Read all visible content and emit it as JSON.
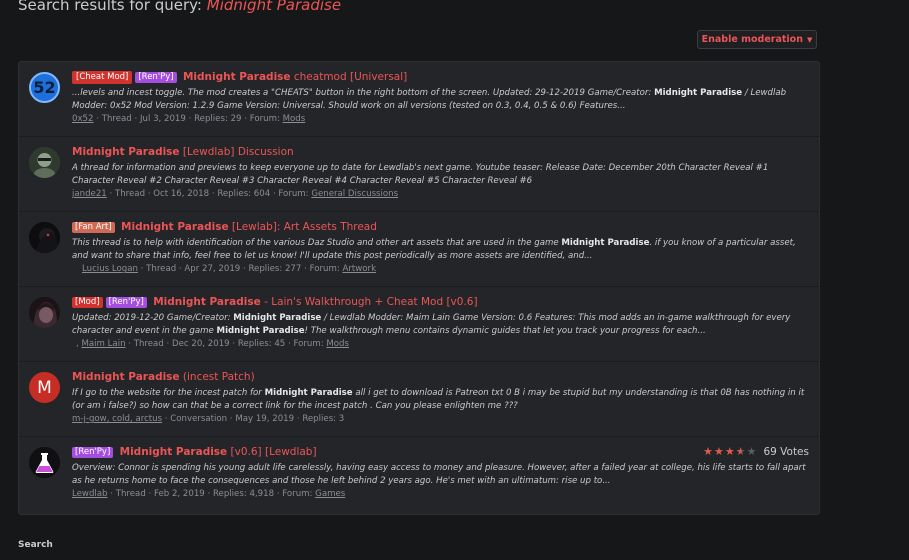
{
  "header": {
    "prefix": "Search results for query: ",
    "query": "Midnight Paradise"
  },
  "moderation_button": {
    "label": "Enable moderation"
  },
  "results": [
    {
      "avatar_text": "52",
      "tags": [
        {
          "text": "[Cheat Mod]",
          "kind": "cheat"
        },
        {
          "text": "[Ren'Py]",
          "kind": "renpy"
        }
      ],
      "title_highlight": "Midnight Paradise",
      "title_rest": " cheatmod [Universal]",
      "snippet_parts": [
        "...levels and incest toggle. The mod creates a \"CHEATS\" button in the right bottom of the screen. Updated: 29-12-2019 Game/Creator: ",
        "Midnight Paradise",
        " / Lewdlab Modder: 0x52 Mod Version: 1.2.9 Game Version: Universal. Should work on all versions (tested on 0.3, 0.4, 0.5 & 0.6) Features..."
      ],
      "author": "0x52",
      "type": "Thread",
      "date": "Jul 3, 2019",
      "replies": "Replies: 29",
      "forum_label": "Forum:",
      "forum": "Mods"
    },
    {
      "tags": [],
      "title_highlight": "Midnight Paradise",
      "title_rest": " [Lewdlab] Discussion",
      "snippet_parts": [
        "A thread for information and previews to keep everyone up to date for Lewdlab's next game. Youtube teaser: Release Date: December 20th Character Reveal #1 Character Reveal #2 Character Reveal #3 Character Reveal #4 Character Reveal #5 Character Reveal #6",
        "",
        ""
      ],
      "author": "jande21",
      "type": "Thread",
      "date": "Oct 16, 2018",
      "replies": "Replies: 604",
      "forum_label": "Forum:",
      "forum": "General Discussions"
    },
    {
      "tags": [
        {
          "text": "[Fan Art]",
          "kind": "fanart"
        }
      ],
      "title_highlight": "Midnight Paradise",
      "title_rest": " [Lewlab]: Art Assets Thread",
      "snippet_parts": [
        "This thread is to help with identification of the various Daz Studio and other art assets that are used in the game ",
        "Midnight Paradise",
        ". if you know of a particular asset, and want to share that info, feel free to let us know! I'll update this post periodically as more assets are identified, and..."
      ],
      "author": "Lucius Logan",
      "type": "Thread",
      "date": "Apr 27, 2019",
      "replies": "Replies: 277",
      "forum_label": "Forum:",
      "forum": "Artwork"
    },
    {
      "tags": [
        {
          "text": "[Mod]",
          "kind": "mod"
        },
        {
          "text": "[Ren'Py]",
          "kind": "renpy"
        }
      ],
      "title_highlight": "Midnight Paradise",
      "title_rest": " - Lain's Walkthrough + Cheat Mod [v0.6]",
      "snippet_parts": [
        "Updated: 2019-12-20 Game/Creator: ",
        "Midnight Paradise",
        " / Lewdlab Modder: Maim Lain Game Version: 0.6 Features: This mod adds an in-game walkthrough for every character and event in the game ",
        "Midnight Paradise",
        "! The walkthrough menu contains dynamic guides that let you track your progress for each..."
      ],
      "author_prefix": ",",
      "author": "Maim Lain",
      "type": "Thread",
      "date": "Dec 20, 2019",
      "replies": "Replies: 45",
      "forum_label": "Forum:",
      "forum": "Mods"
    },
    {
      "avatar_text": "M",
      "tags": [],
      "title_highlight": "Midnight Paradise",
      "title_rest": " (incest Patch)",
      "snippet_parts": [
        "If I go to the website for the incest patch for ",
        "Midnight Paradise",
        " all i get to download is Patreon txt 0 B i may be stupid but my understanding is that 0B has nothing in it (or am i false?) so how can that be a correct link for the incest patch . Can you please enlighten me ???"
      ],
      "author": "m-j-gow, cold, arctus",
      "type": "Conversation",
      "date": "May 19, 2019",
      "replies": "Replies: 3"
    },
    {
      "tags": [
        {
          "text": "[Ren'Py]",
          "kind": "renpy"
        }
      ],
      "title_highlight": "Midnight Paradise",
      "title_rest": " [v0.6] [Lewdlab]",
      "rating_value": 3.5,
      "votes": "69 Votes",
      "snippet_parts": [
        "Overview: Connor is spending his young adult life carelessly, having easy access to money and pleasure. However, after a failed year at college, his life starts to fall apart as he returns home to face the consequences and those he left behind 2 years ago. He's met with an ultimatum: rise up to...",
        "",
        ""
      ],
      "author": "Lewdlab",
      "type": "Thread",
      "date": "Feb 2, 2019",
      "replies": "Replies: 4,918",
      "forum_label": "Forum:",
      "forum": "Games"
    }
  ],
  "footer": {
    "label": "Search"
  }
}
